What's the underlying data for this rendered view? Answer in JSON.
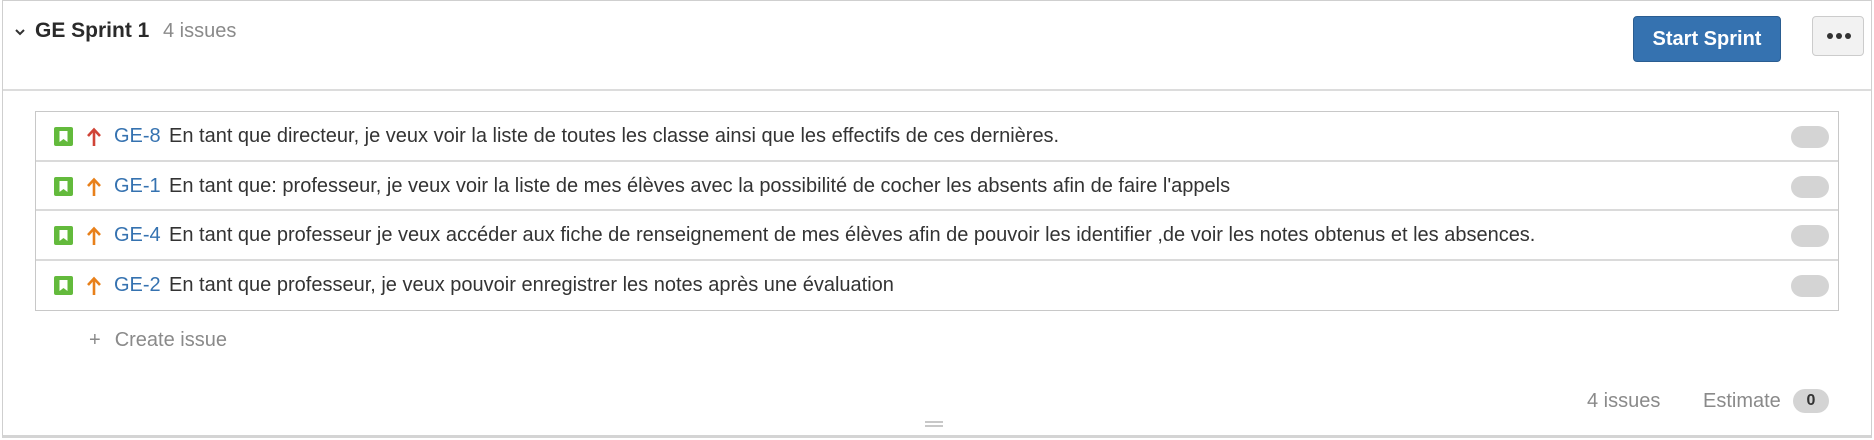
{
  "sprint": {
    "name": "GE Sprint 1",
    "issue_count": "4 issues",
    "start_button": "Start Sprint",
    "more_icon": "ellipsis-icon"
  },
  "issues": [
    {
      "key": "GE-8",
      "summary": "En tant que directeur, je veux voir la liste de toutes les classe ainsi que les effectifs de ces dernières.",
      "priority": "highest",
      "priority_color": "#d04437"
    },
    {
      "key": "GE-1",
      "summary": "En tant que: professeur, je veux voir la liste de mes élèves avec la possibilité de cocher les absents afin de faire l'appels",
      "priority": "high",
      "priority_color": "#e8801a"
    },
    {
      "key": "GE-4",
      "summary": "En tant que professeur je veux accéder aux fiche de renseignement de mes élèves afin de pouvoir les identifier ,de voir les notes obtenus et les absences.",
      "priority": "high",
      "priority_color": "#e8801a"
    },
    {
      "key": "GE-2",
      "summary": "En tant que professeur, je veux pouvoir enregistrer les notes après une évaluation",
      "priority": "high",
      "priority_color": "#e8801a"
    }
  ],
  "create_issue": {
    "plus": "+",
    "label": "Create issue"
  },
  "footer": {
    "issues": "4 issues",
    "estimate_label": "Estimate",
    "estimate_value": "0"
  },
  "colors": {
    "story": "#63ba3c",
    "link": "#3572b0",
    "primary_button": "#3572b0"
  }
}
